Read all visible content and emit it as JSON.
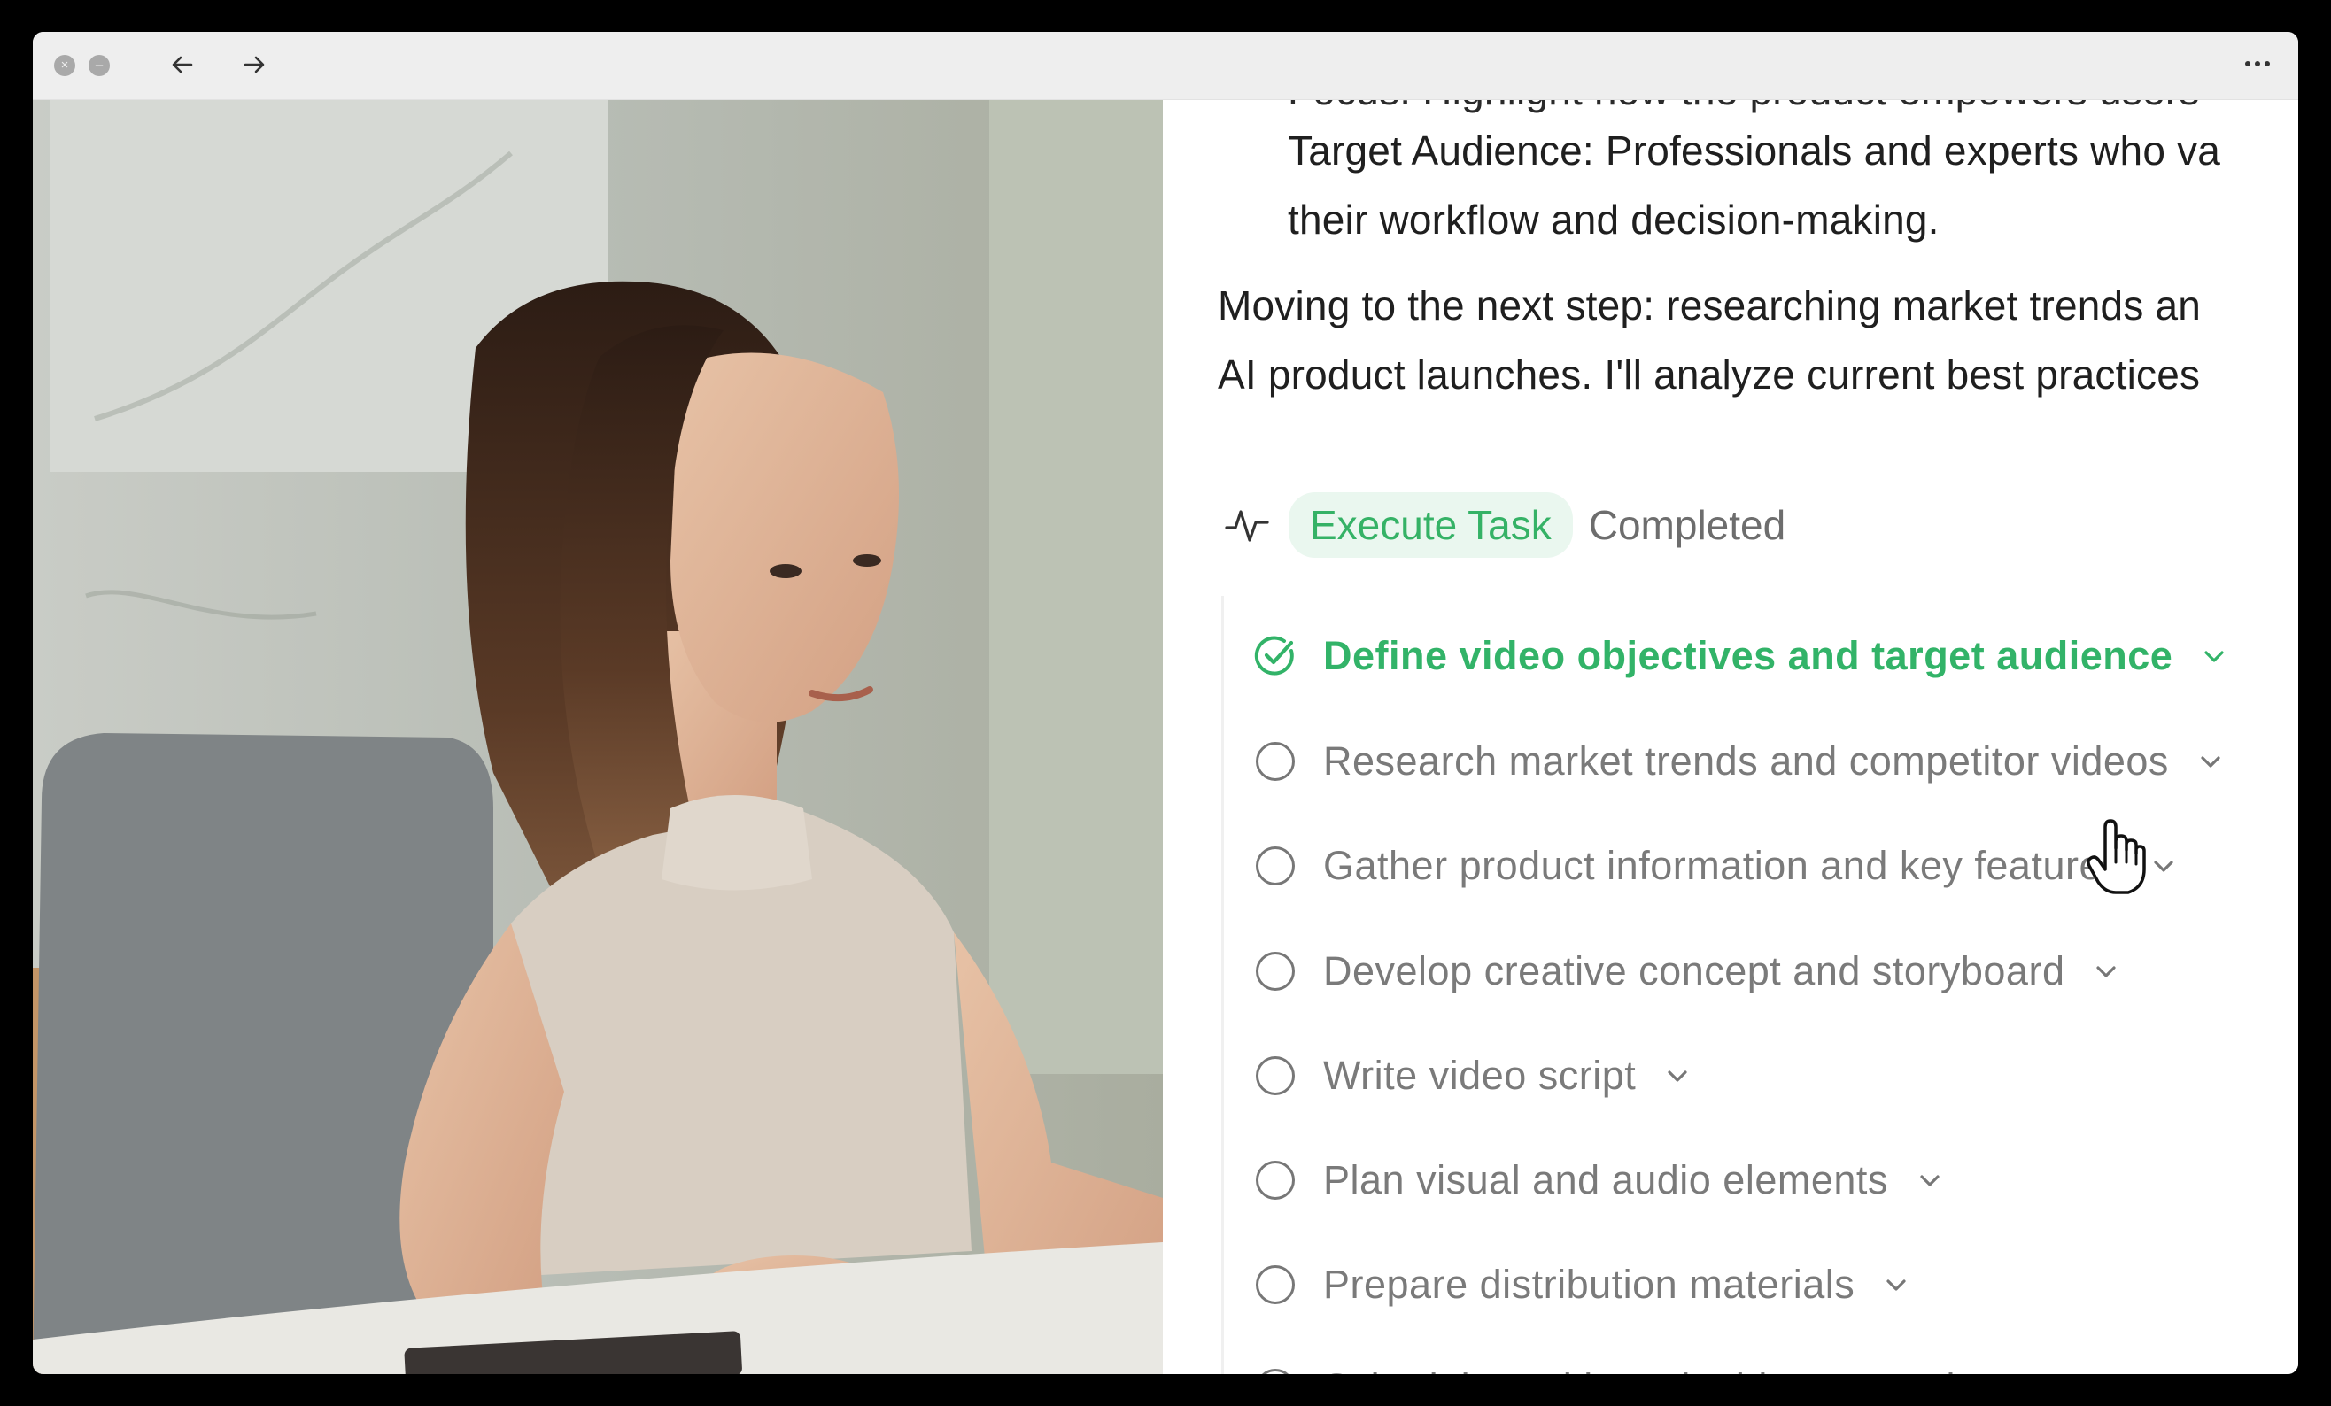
{
  "titlebar": {
    "close_glyph": "×",
    "minimize_glyph": "–",
    "back_icon": "arrow-left-icon",
    "forward_icon": "arrow-right-icon",
    "more_icon": "more-dots-icon"
  },
  "content": {
    "partial_line": "Focus: Highlight how the product empowers users",
    "target_line_1": "Target Audience: Professionals and experts who va",
    "target_line_2": "their workflow and decision-making.",
    "next_step_1": "Moving to the next step: researching market trends an",
    "next_step_2": "AI product launches. I'll analyze current best practices"
  },
  "execute": {
    "icon": "activity-pulse-icon",
    "pill_label": "Execute Task",
    "status": "Completed"
  },
  "tasks": [
    {
      "label": "Define video objectives and target audience",
      "done": true
    },
    {
      "label": "Research market trends and competitor videos",
      "done": false
    },
    {
      "label": "Gather product information and key features",
      "done": false
    },
    {
      "label": "Develop creative concept and storyboard",
      "done": false
    },
    {
      "label": "Write video script",
      "done": false
    },
    {
      "label": "Plan visual and audio elements",
      "done": false
    },
    {
      "label": "Prepare distribution materials",
      "done": false
    },
    {
      "label": "Schedule and launch video campaign",
      "done": false
    }
  ],
  "colors": {
    "accent_green": "#32b368",
    "pill_bg": "#eaf7ef",
    "muted_text": "#7a7a7a",
    "titlebar_bg": "#eeeeee"
  }
}
